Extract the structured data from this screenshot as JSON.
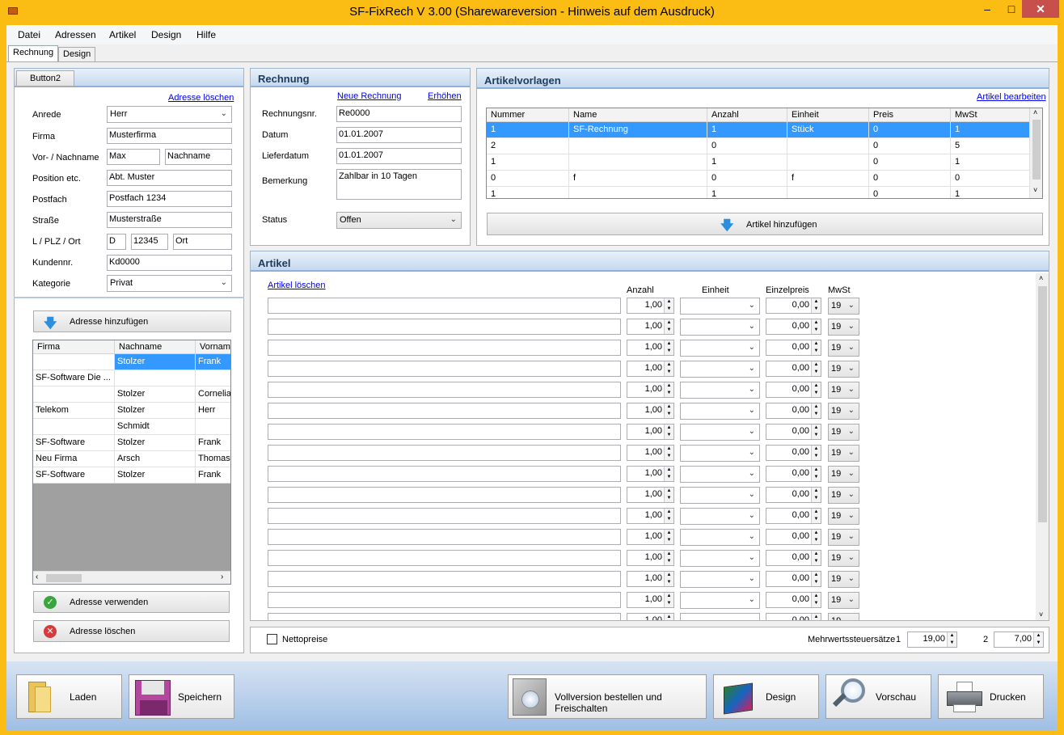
{
  "window": {
    "title": "SF-FixRech  V 3.00 (Sharewareversion - Hinweis auf dem Ausdruck)"
  },
  "menu": [
    "Datei",
    "Adressen",
    "Artikel",
    "Design",
    "Hilfe"
  ],
  "tabs": [
    "Rechnung",
    "Design"
  ],
  "address": {
    "button2": "Button2",
    "delete_link": "Adresse löschen",
    "anrede_label": "Anrede",
    "anrede": "Herr",
    "firma_label": "Firma",
    "firma": "Musterfirma",
    "name_label": "Vor- / Nachname",
    "vorname": "Max",
    "nachname": "Nachname",
    "position_label": "Position etc.",
    "position": "Abt. Muster",
    "postfach_label": "Postfach",
    "postfach": "Postfach 1234",
    "strasse_label": "Straße",
    "strasse": "Musterstraße",
    "lpo_label": "L / PLZ / Ort",
    "land": "D",
    "plz": "12345",
    "ort": "Ort",
    "kundennr_label": "Kundennr.",
    "kundennr": "Kd0000",
    "kategorie_label": "Kategorie",
    "kategorie": "Privat",
    "add_button": "Adresse hinzufügen",
    "use_button": "Adresse verwenden",
    "delete_button": "Adresse löschen",
    "grid": {
      "headers": [
        "Firma",
        "Nachname",
        "Vorname"
      ],
      "rows": [
        [
          "",
          "Stolzer",
          "Frank"
        ],
        [
          "SF-Software Die ...",
          "",
          ""
        ],
        [
          "",
          "Stolzer",
          "Cornelia"
        ],
        [
          "Telekom",
          "Stolzer",
          "Herr"
        ],
        [
          "",
          "Schmidt",
          ""
        ],
        [
          "SF-Software",
          "Stolzer",
          "Frank"
        ],
        [
          "Neu Firma",
          "Arsch",
          "Thomas"
        ],
        [
          "SF-Software",
          "Stolzer",
          "Frank"
        ]
      ]
    }
  },
  "invoice": {
    "title": "Rechnung",
    "new_link": "Neue Rechnung",
    "increase_link": "Erhöhen",
    "nr_label": "Rechnungsnr.",
    "nr": "Re0000",
    "datum_label": "Datum",
    "datum": "01.01.2007",
    "lieferdatum_label": "Lieferdatum",
    "lieferdatum": "01.01.2007",
    "bemerkung_label": "Bemerkung",
    "bemerkung": "Zahlbar in 10 Tagen",
    "status_label": "Status",
    "status": "Offen"
  },
  "templates": {
    "title": "Artikelvorlagen",
    "edit_link": "Artikel bearbeiten",
    "add_button": "Artikel hinzufügen",
    "headers": [
      "Nummer",
      "Name",
      "Anzahl",
      "Einheit",
      "Preis",
      "MwSt"
    ],
    "rows": [
      [
        "1",
        "SF-Rechnung",
        "1",
        "Stück",
        "0",
        "1"
      ],
      [
        "2",
        "",
        "0",
        "",
        "0",
        "5"
      ],
      [
        "1",
        "",
        "1",
        "",
        "0",
        "1"
      ],
      [
        "0",
        "f",
        "0",
        "f",
        "0",
        "0"
      ],
      [
        "1",
        "",
        "1",
        "",
        "0",
        "1"
      ]
    ]
  },
  "articles": {
    "title": "Artikel",
    "delete_link": "Artikel löschen",
    "col_anzahl": "Anzahl",
    "col_einheit": "Einheit",
    "col_preis": "Einzelpreis",
    "col_mwst": "MwSt",
    "row_count": 16,
    "row": {
      "anzahl": "1,00",
      "preis": "0,00",
      "mwst": "19"
    }
  },
  "footer": {
    "netto_label": "Nettopreise",
    "mwst_label": "Mehrwertssteuersätze",
    "mwst1_idx": "1",
    "mwst1": "19,00",
    "mwst2_idx": "2",
    "mwst2": "7,00"
  },
  "bottom_buttons": {
    "laden": "Laden",
    "speichern": "Speichern",
    "vollversion": "Vollversion bestellen und Freischalten",
    "design": "Design",
    "vorschau": "Vorschau",
    "drucken": "Drucken"
  },
  "colors": {
    "titlebar": "#fbbc13",
    "selection": "#3399ff",
    "close": "#e81123"
  }
}
